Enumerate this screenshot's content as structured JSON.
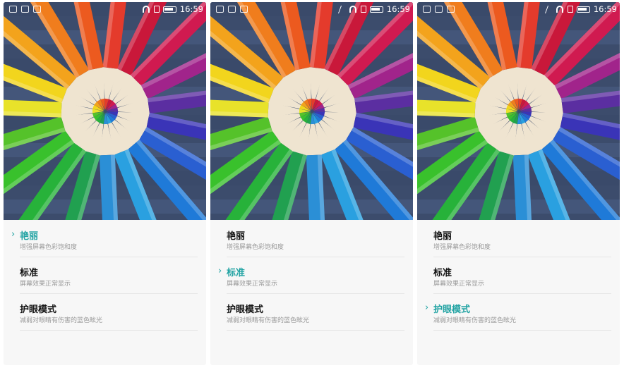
{
  "status_bar": {
    "time": "16:59"
  },
  "modes": [
    {
      "title": "艳丽",
      "subtitle": "增强屏幕色彩饱和度"
    },
    {
      "title": "标准",
      "subtitle": "屏幕效果正常显示"
    },
    {
      "title": "护眼模式",
      "subtitle": "减弱对眼睛有伤害的蓝色眩光"
    }
  ],
  "screens": [
    {
      "selected_mode": "艳丽"
    },
    {
      "selected_mode": "标准"
    },
    {
      "selected_mode": "护眼模式"
    }
  ],
  "colors": {
    "accent": "#21a3a3",
    "pencils": [
      "#e43b2c",
      "#c9183a",
      "#d01a50",
      "#a1248b",
      "#5b2ea1",
      "#3a34b7",
      "#2a5fd1",
      "#1f7ad8",
      "#2aa0e0",
      "#2b8fd6",
      "#21a050",
      "#27b23a",
      "#39c12c",
      "#55c22a",
      "#e8e22a",
      "#f2d51d",
      "#f3a31c",
      "#f07d1d",
      "#ec5a1f"
    ]
  }
}
